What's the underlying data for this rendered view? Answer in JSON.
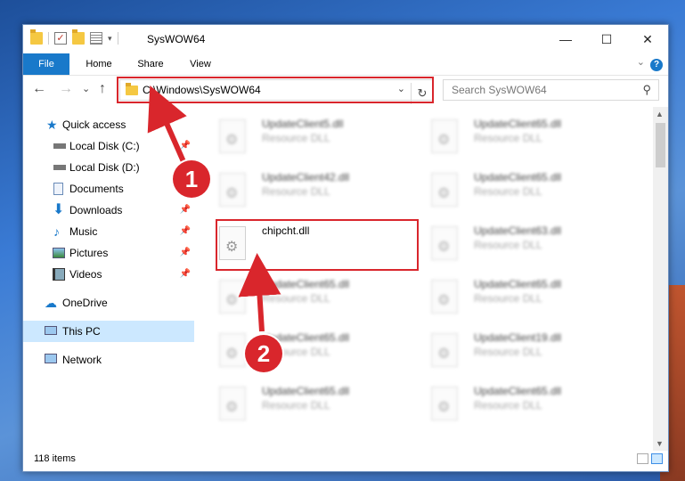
{
  "window": {
    "title": "SysWOW64"
  },
  "window_controls": {
    "minimize": "—",
    "maximize": "☐",
    "close": "✕"
  },
  "ribbon": {
    "tabs": [
      "File",
      "Home",
      "Share",
      "View"
    ],
    "help": "?",
    "expand_chevron": "⌄"
  },
  "nav": {
    "back": "←",
    "forward": "→",
    "recent": "⌄",
    "up": "↑"
  },
  "address": {
    "path": "C:\\Windows\\SysWOW64",
    "dropdown": "⌄",
    "refresh": "↻"
  },
  "search": {
    "placeholder": "Search SysWOW64",
    "icon": "⚲"
  },
  "sidebar": {
    "items": [
      {
        "label": "Quick access",
        "icon": "star-icon",
        "pinned": false
      },
      {
        "label": "Local Disk (C:)",
        "icon": "drive-icon",
        "pinned": true
      },
      {
        "label": "Local Disk (D:)",
        "icon": "drive-icon",
        "pinned": false
      },
      {
        "label": "Documents",
        "icon": "documents-icon",
        "pinned": true
      },
      {
        "label": "Downloads",
        "icon": "download-icon",
        "pinned": true
      },
      {
        "label": "Music",
        "icon": "music-icon",
        "pinned": true
      },
      {
        "label": "Pictures",
        "icon": "pictures-icon",
        "pinned": true
      },
      {
        "label": "Videos",
        "icon": "videos-icon",
        "pinned": true
      },
      {
        "label": "OneDrive",
        "icon": "cloud-icon",
        "pinned": false
      },
      {
        "label": "This PC",
        "icon": "computer-icon",
        "pinned": false,
        "selected": true
      },
      {
        "label": "Network",
        "icon": "network-icon",
        "pinned": false
      }
    ]
  },
  "files": {
    "left": [
      {
        "name": "UpdateClient5.dll",
        "desc": "Resource DLL"
      },
      {
        "name": "UpdateClient42.dll",
        "desc": "Resource DLL"
      },
      {
        "name": "chipcht.dll",
        "desc": ""
      },
      {
        "name": "UpdateClient65.dll",
        "desc": "Resource DLL"
      },
      {
        "name": "UpdateClient65.dll",
        "desc": "Resource DLL"
      },
      {
        "name": "UpdateClient65.dll",
        "desc": "Resource DLL"
      }
    ],
    "right": [
      {
        "name": "UpdateClient65.dll",
        "desc": "Resource DLL"
      },
      {
        "name": "UpdateClient65.dll",
        "desc": "Resource DLL"
      },
      {
        "name": "UpdateClient63.dll",
        "desc": "Resource DLL"
      },
      {
        "name": "UpdateClient65.dll",
        "desc": "Resource DLL"
      },
      {
        "name": "UpdateClient19.dll",
        "desc": "Resource DLL"
      },
      {
        "name": "UpdateClient65.dll",
        "desc": "Resource DLL"
      }
    ]
  },
  "status": {
    "count": "118 items"
  },
  "callouts": {
    "one": "1",
    "two": "2"
  },
  "colors": {
    "accent": "#1979ca",
    "highlight": "#d9262c",
    "selected": "#cce8ff"
  }
}
